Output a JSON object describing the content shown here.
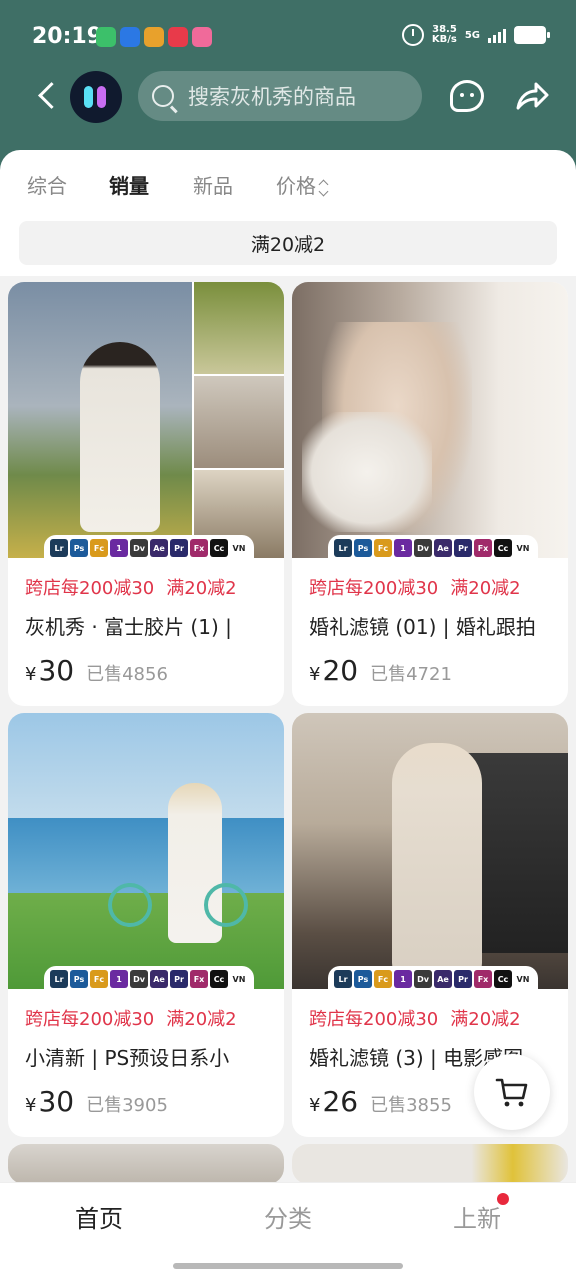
{
  "status_bar": {
    "time": "20:19",
    "speed_value": "38.5",
    "speed_unit": "KB/s",
    "network": "5G"
  },
  "header": {
    "search_placeholder": "搜索灰机秀的商品"
  },
  "sort_tabs": [
    {
      "label": "综合",
      "active": false
    },
    {
      "label": "销量",
      "active": true
    },
    {
      "label": "新品",
      "active": false
    },
    {
      "label": "价格",
      "active": false
    }
  ],
  "promo_filter": "满20减2",
  "products": [
    {
      "promo1": "跨店每200减30",
      "promo2": "满20减2",
      "title": "灰机秀 · 富士胶片 (1) | ",
      "currency": "¥",
      "price": "30",
      "sold": "已售4856"
    },
    {
      "promo1": "跨店每200减30",
      "promo2": "满20减2",
      "title": "婚礼滤镜 (01) | 婚礼跟拍",
      "currency": "¥",
      "price": "20",
      "sold": "已售4721"
    },
    {
      "promo1": "跨店每200减30",
      "promo2": "满20减2",
      "title": "小清新 | PS预设日系小",
      "currency": "¥",
      "price": "30",
      "sold": "已售3905"
    },
    {
      "promo1": "跨店每200减30",
      "promo2": "满20减2",
      "title": "婚礼滤镜 (3) | 电影感图",
      "currency": "¥",
      "price": "26",
      "sold": "已售3855"
    }
  ],
  "software_badges": [
    "Lr",
    "Ps",
    "Fc",
    "1",
    "Dv",
    "Ae",
    "Pr",
    "Fx",
    "Cc",
    "VN"
  ],
  "badge_colors": [
    "#1c3b5a",
    "#1c5a9a",
    "#d99a1c",
    "#6a2aa0",
    "#3a3a3a",
    "#3a2a6a",
    "#2a2a6a",
    "#a02a6a",
    "#111111",
    "#ffffff"
  ],
  "bottom_nav": [
    {
      "label": "首页",
      "active": true
    },
    {
      "label": "分类",
      "active": false
    },
    {
      "label": "上新",
      "active": false
    }
  ],
  "colors": {
    "header_bg": "#3f6f66",
    "promo_red": "#e0354a",
    "notify_dot": "#e8283c"
  }
}
